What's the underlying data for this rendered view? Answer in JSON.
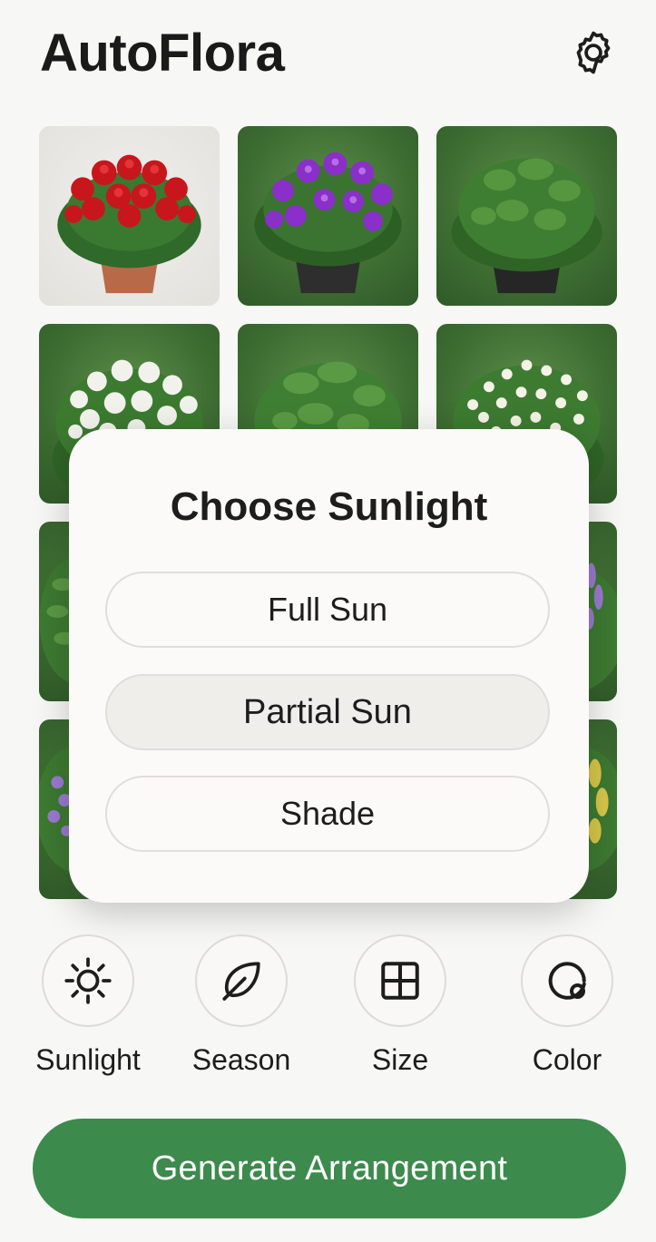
{
  "header": {
    "title": "AutoFlora",
    "settings_icon": "gear-icon"
  },
  "plants": [
    {
      "name": "red-geranium",
      "flower_color": "#c8161d",
      "pot_color": "#b86a48",
      "background": "light"
    },
    {
      "name": "purple-petunia",
      "flower_color": "#8a2fc9",
      "pot_color": "#2e2e2e",
      "background": "green"
    },
    {
      "name": "green-foliage",
      "flower_color": "#3f7a2f",
      "pot_color": "#262626",
      "background": "green"
    },
    {
      "name": "white-bloom",
      "flower_color": "#f2f2ec",
      "pot_color": "",
      "background": "green"
    },
    {
      "name": "green-shrub",
      "flower_color": "#3f7a2f",
      "pot_color": "",
      "background": "green"
    },
    {
      "name": "white-star-bloom",
      "flower_color": "#f5f3e6",
      "pot_color": "",
      "background": "green"
    },
    {
      "name": "green-fern",
      "flower_color": "#3f7a2f",
      "pot_color": "",
      "background": "green"
    },
    {
      "name": "hidden-center",
      "flower_color": "#3f7a2f",
      "pot_color": "",
      "background": "green"
    },
    {
      "name": "lavender-spike",
      "flower_color": "#9b7ad0",
      "pot_color": "",
      "background": "green"
    },
    {
      "name": "lavender-bloom",
      "flower_color": "#9b7ad0",
      "pot_color": "",
      "background": "green"
    },
    {
      "name": "hidden-center-2",
      "flower_color": "#3f7a2f",
      "pot_color": "",
      "background": "green"
    },
    {
      "name": "yellow-spike",
      "flower_color": "#d8c84a",
      "pot_color": "",
      "background": "green"
    }
  ],
  "modal": {
    "title": "Choose Sunlight",
    "options": [
      {
        "label": "Full Sun",
        "selected": false
      },
      {
        "label": "Partial Sun",
        "selected": true
      },
      {
        "label": "Shade",
        "selected": false
      }
    ]
  },
  "filters": [
    {
      "label": "Sunlight",
      "icon": "sun-icon"
    },
    {
      "label": "Season",
      "icon": "leaf-icon"
    },
    {
      "label": "Size",
      "icon": "grid-icon"
    },
    {
      "label": "Color",
      "icon": "palette-icon"
    }
  ],
  "generate": {
    "label": "Generate Arrangement",
    "color": "#3c8a4c"
  }
}
